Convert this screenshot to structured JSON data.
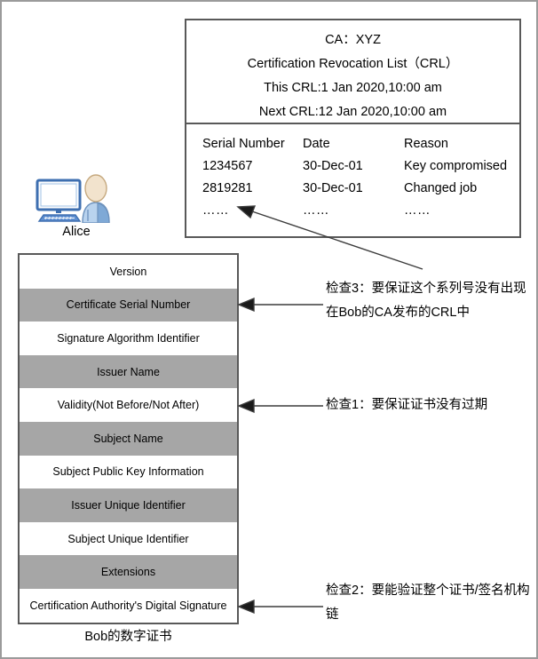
{
  "crl": {
    "header_lines": [
      "CA：XYZ",
      "Certification Revocation List（CRL）",
      "This CRL:1 Jan 2020,10:00 am",
      "Next CRL:12 Jan 2020,10:00 am"
    ],
    "columns": [
      "Serial Number",
      "Date",
      "Reason"
    ],
    "rows": [
      [
        "1234567",
        "30-Dec-01",
        "Key compromised"
      ],
      [
        "2819281",
        "30-Dec-01",
        "Changed job"
      ],
      [
        "……",
        "……",
        "……"
      ]
    ]
  },
  "alice": {
    "label": "Alice",
    "monitor_icon": "computer-monitor-icon",
    "avatar_icon": "user-avatar-icon"
  },
  "certificate": {
    "caption": "Bob的数字证书",
    "fields": [
      {
        "label": "Version",
        "shade": "white"
      },
      {
        "label": "Certificate Serial Number",
        "shade": "gray"
      },
      {
        "label": "Signature Algorithm Identifier",
        "shade": "white"
      },
      {
        "label": "Issuer Name",
        "shade": "gray"
      },
      {
        "label": "Validity(Not Before/Not After)",
        "shade": "white"
      },
      {
        "label": "Subject Name",
        "shade": "gray"
      },
      {
        "label": "Subject Public Key Information",
        "shade": "white"
      },
      {
        "label": "Issuer Unique Identifier",
        "shade": "gray"
      },
      {
        "label": "Subject Unique Identifier",
        "shade": "white"
      },
      {
        "label": "Extensions",
        "shade": "gray"
      },
      {
        "label": "Certification Authority's Digital Signature",
        "shade": "white"
      }
    ]
  },
  "annotations": {
    "check3": "检查3：要保证这个系列号没有出现在Bob的CA发布的CRL中",
    "check1": "检查1：要保证证书没有过期",
    "check2": "检查2：要能验证整个证书/签名机构链"
  },
  "colors": {
    "shade_gray": "#a6a6a6",
    "border_dark": "#595959",
    "page_border": "#9b9b9b",
    "icon_blue": "#4a79b8",
    "arrow": "#3b3b3b"
  }
}
